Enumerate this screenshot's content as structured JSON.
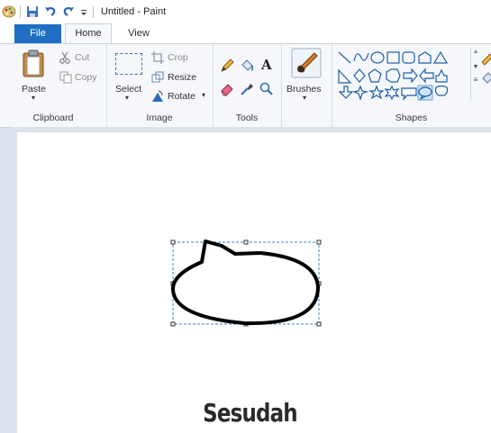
{
  "titlebar": {
    "title": "Untitled - Paint"
  },
  "tabs": {
    "file": "File",
    "home": "Home",
    "view": "View"
  },
  "clipboard": {
    "paste": "Paste",
    "cut": "Cut",
    "copy": "Copy",
    "title": "Clipboard"
  },
  "image": {
    "select": "Select",
    "crop": "Crop",
    "resize": "Resize",
    "rotate": "Rotate",
    "title": "Image"
  },
  "tools": {
    "title": "Tools",
    "text_glyph": "A"
  },
  "brushes": {
    "label": "Brushes"
  },
  "shapes": {
    "title": "Shapes"
  },
  "caption": "Sesudah",
  "colors": {
    "accent": "#1e6fc4",
    "shape_stroke": "#1f5fa8",
    "shape_fill_selected": "#cfe3fb"
  }
}
